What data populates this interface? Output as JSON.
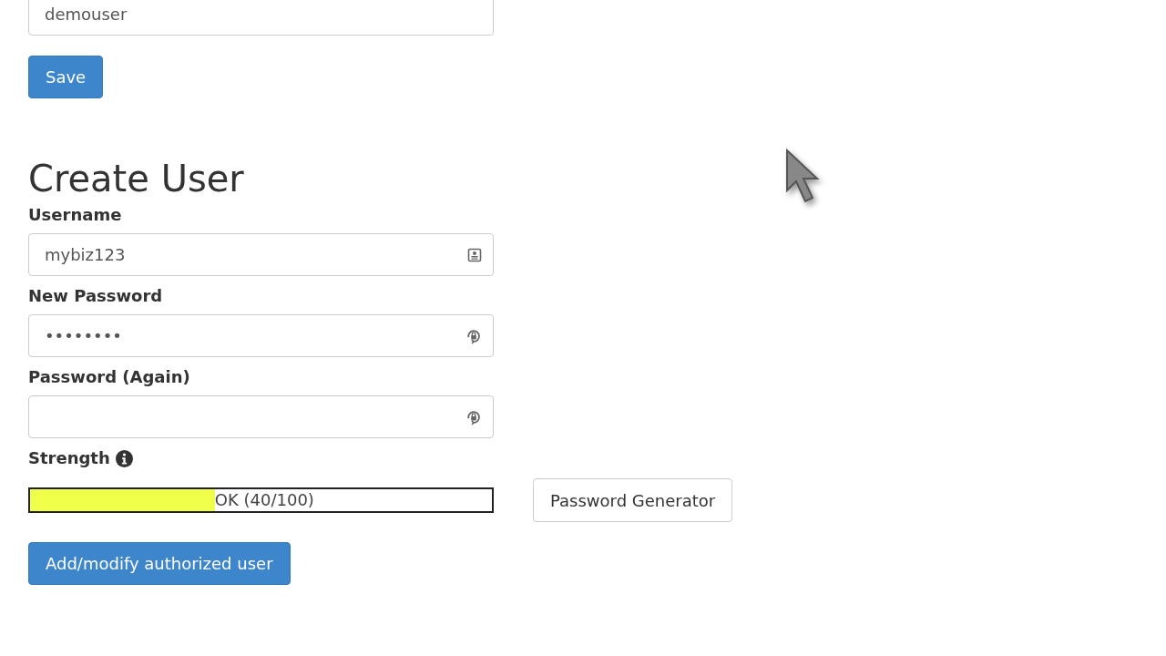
{
  "top_field": {
    "value": "demouser"
  },
  "save_button": "Save",
  "heading": "Create User",
  "fields": [
    {
      "label": "Username",
      "value": "mybiz123",
      "kind": "user"
    },
    {
      "label": "New Password",
      "value": "••••••••",
      "kind": "password"
    },
    {
      "label": "Password (Again)",
      "kind": "password"
    }
  ],
  "strength": {
    "label": "Strength",
    "level": 0.4,
    "reading": "OK (40/100)"
  },
  "generator_button": "Password Generator",
  "submit_button": "Add/modify authorized user"
}
